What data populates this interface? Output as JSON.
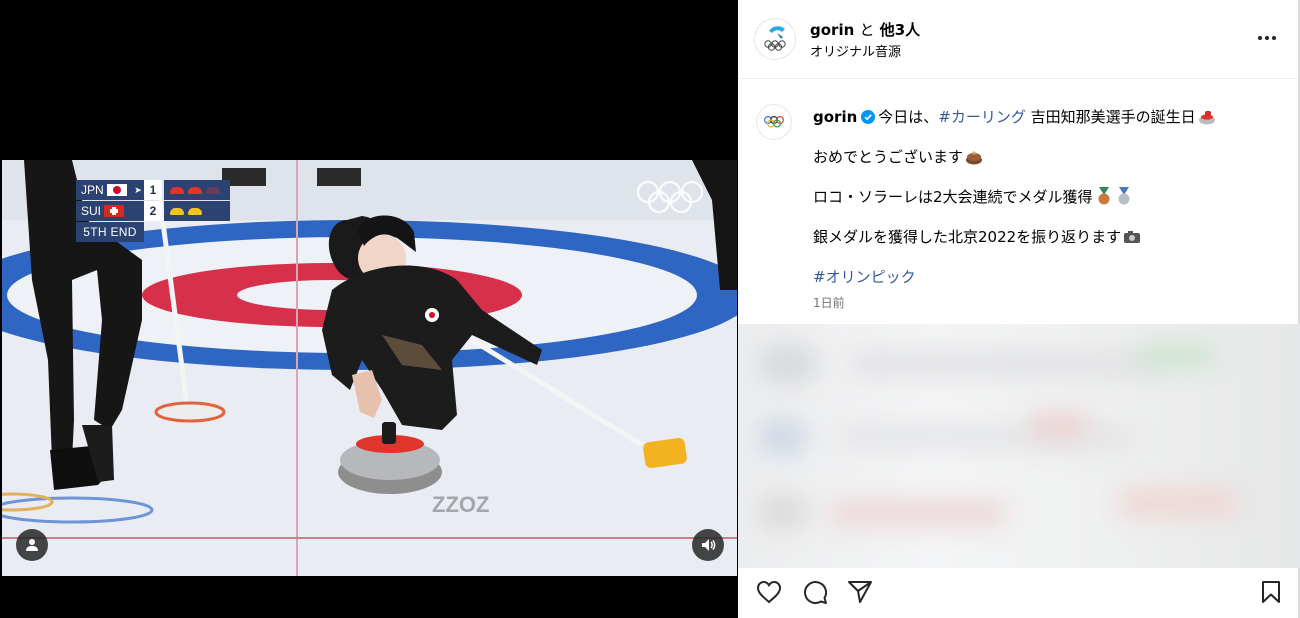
{
  "scoreboard": {
    "teams": [
      {
        "code": "JPN",
        "hammer": "➤",
        "score": "1",
        "stone_color": "red"
      },
      {
        "code": "SUI",
        "hammer": "",
        "score": "2",
        "stone_color": "yellow"
      }
    ],
    "end_label": "5TH END"
  },
  "post": {
    "header": {
      "username": "gorin",
      "conjunction": "と",
      "others": "他3人",
      "audio": "オリジナル音源"
    },
    "caption": {
      "username": "gorin",
      "line1_prefix": "今日は、",
      "line1_hashtag": "#カーリング",
      "line1_suffix": " 吉田知那美選手の誕生日",
      "line2": "おめでとうございます",
      "line3": "ロコ・ソラーレは2大会連続でメダル獲得",
      "line4": "銀メダルを獲得した北京2022を振り返ります",
      "hashtag": "#オリンピック",
      "time": "1日前"
    }
  },
  "icons": {
    "more": "more-horizontal-icon",
    "like": "heart-icon",
    "comment": "comment-icon",
    "share": "send-icon",
    "save": "bookmark-icon",
    "user": "user-icon",
    "volume": "speaker-icon"
  },
  "colors": {
    "hashtag": "#385898",
    "verified": "#0095f6",
    "scoreboard": "#2b4272"
  }
}
